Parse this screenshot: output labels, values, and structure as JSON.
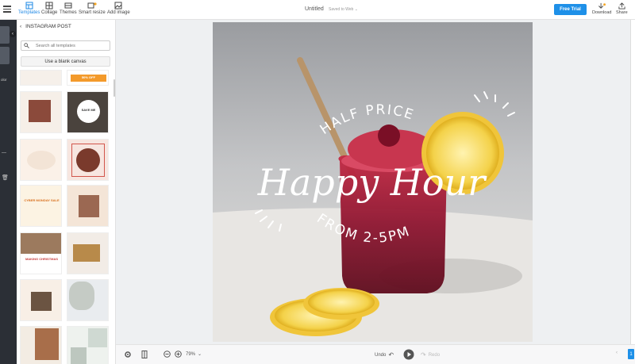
{
  "toolbar": {
    "templates": "Templates",
    "collage": "Collage",
    "themes": "Themes",
    "smart_resize": "Smart resize",
    "add_image": "Add image"
  },
  "document": {
    "title": "Untitled",
    "status": "Saved to Web"
  },
  "actions": {
    "free_trial": "Free Trial",
    "download": "Download",
    "share": "Share"
  },
  "side_strip": {
    "label": "olor"
  },
  "panel": {
    "header": "INSTAGRAM POST",
    "search_placeholder": "Search all templates",
    "blank_canvas": "Use a blank canvas"
  },
  "thumbnails": {
    "cyber_monday": "CYBER MONDAY SALE",
    "making_christmas": "MAKING CHRISTMAS",
    "save_me": "SAVE ME",
    "sale_badge": "50% OFF"
  },
  "design": {
    "half_price": "HALF PRICE",
    "happy_hour": "Happy Hour",
    "from_time": "FROM 2-5PM"
  },
  "bottom": {
    "zoom": "79%",
    "undo": "Undo",
    "redo": "Redo",
    "page_badge": "1"
  },
  "colors": {
    "accent": "#1e90e8",
    "dark_strip": "#2b2f36"
  }
}
